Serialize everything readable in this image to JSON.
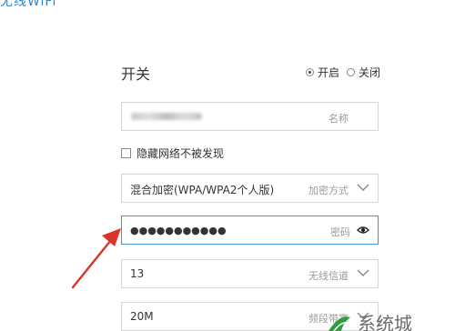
{
  "header": {
    "title": "无线WiFi"
  },
  "switch": {
    "label": "开关",
    "on_label": "开启",
    "off_label": "关闭",
    "selected": "on"
  },
  "name_field": {
    "value": "hwang2017",
    "hint": "名称"
  },
  "hidden_network": {
    "label": "隐藏网络不被发现",
    "checked": false
  },
  "encryption": {
    "value": "混合加密(WPA/WPA2个人版)",
    "hint": "加密方式"
  },
  "password": {
    "value": "●●●●●●●●●●●",
    "hint": "密码"
  },
  "channel": {
    "value": "13",
    "hint": "无线信道"
  },
  "bandwidth": {
    "value": "20M",
    "hint": "频段带宽"
  },
  "colors": {
    "accent": "#4a8fd6",
    "arrow": "#d9332b",
    "watermark": "#2f9e3a"
  },
  "watermark": {
    "text": "系统城"
  }
}
